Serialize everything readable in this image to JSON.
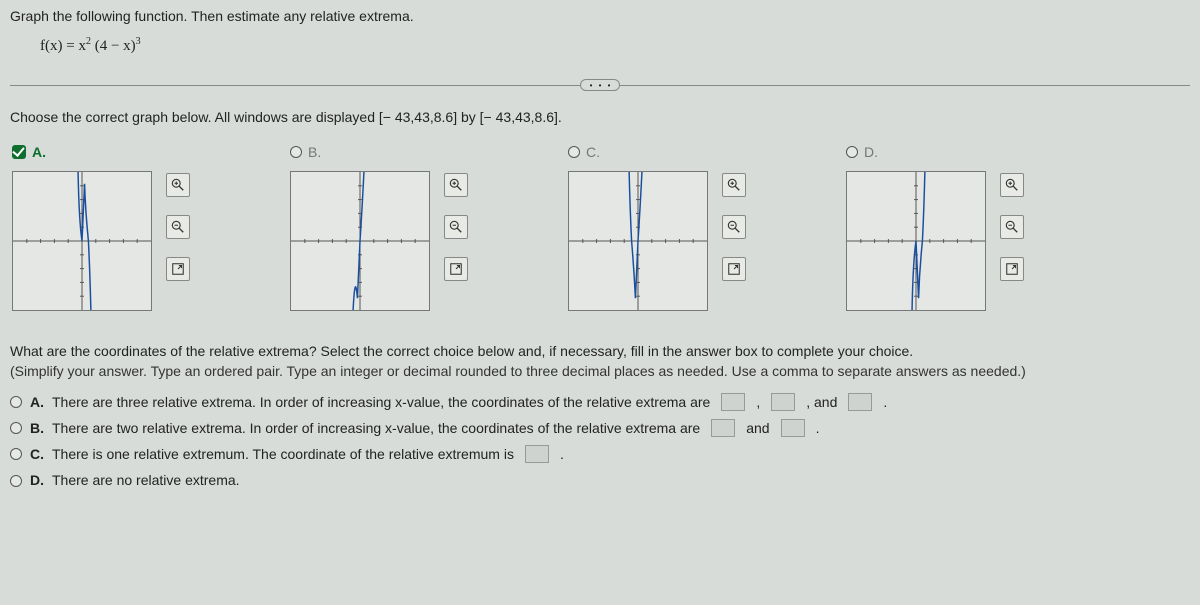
{
  "title": "Graph the following function. Then estimate any relative extrema.",
  "equation_html": "f(x) = x<sup>2</sup> (4 − x)<sup>3</sup>",
  "ellipsis": "• • •",
  "subhead": "Choose the correct graph below. All windows are displayed [− 43,43,8.6] by [− 43,43,8.6].",
  "options": {
    "A": {
      "label": "A.",
      "selected": true
    },
    "B": {
      "label": "B.",
      "selected": false
    },
    "C": {
      "label": "C.",
      "selected": false
    },
    "D": {
      "label": "D.",
      "selected": false
    }
  },
  "extrema_question": "What are the coordinates of the relative extrema? Select the correct choice below and, if necessary, fill in the answer box to complete your choice.",
  "extrema_hint": "(Simplify your answer. Type an ordered pair. Type an integer or decimal rounded to three decimal places as needed. Use a comma to separate answers as needed.)",
  "choices": {
    "A": {
      "letter": "A.",
      "pre": "There are three relative extrema. In order of increasing x-value, the coordinates of the relative extrema are",
      "mid1": ",",
      "mid2": ", and",
      "post": "."
    },
    "B": {
      "letter": "B.",
      "pre": "There are two relative extrema. In order of increasing x-value, the coordinates of the relative extrema are",
      "mid": "and",
      "post": "."
    },
    "C": {
      "letter": "C.",
      "pre": "There is one relative extremum. The coordinate of the relative extremum is",
      "post": "."
    },
    "D": {
      "letter": "D.",
      "pre": "There are no relative extrema."
    }
  },
  "chart_data": {
    "type": "line",
    "function": "f(x) = x^2 (4 - x)^3",
    "window": {
      "xmin": -43,
      "xmax": 43,
      "ymin": -43,
      "ymax": 43,
      "xscale": 8.6,
      "yscale": 8.6
    },
    "relative_extrema": [
      {
        "x": 0,
        "y": 0,
        "type": "min"
      },
      {
        "x": 1.6,
        "y": 35.389,
        "type": "max"
      }
    ],
    "options": [
      "A",
      "B",
      "C",
      "D"
    ],
    "correct_graph": "A"
  }
}
